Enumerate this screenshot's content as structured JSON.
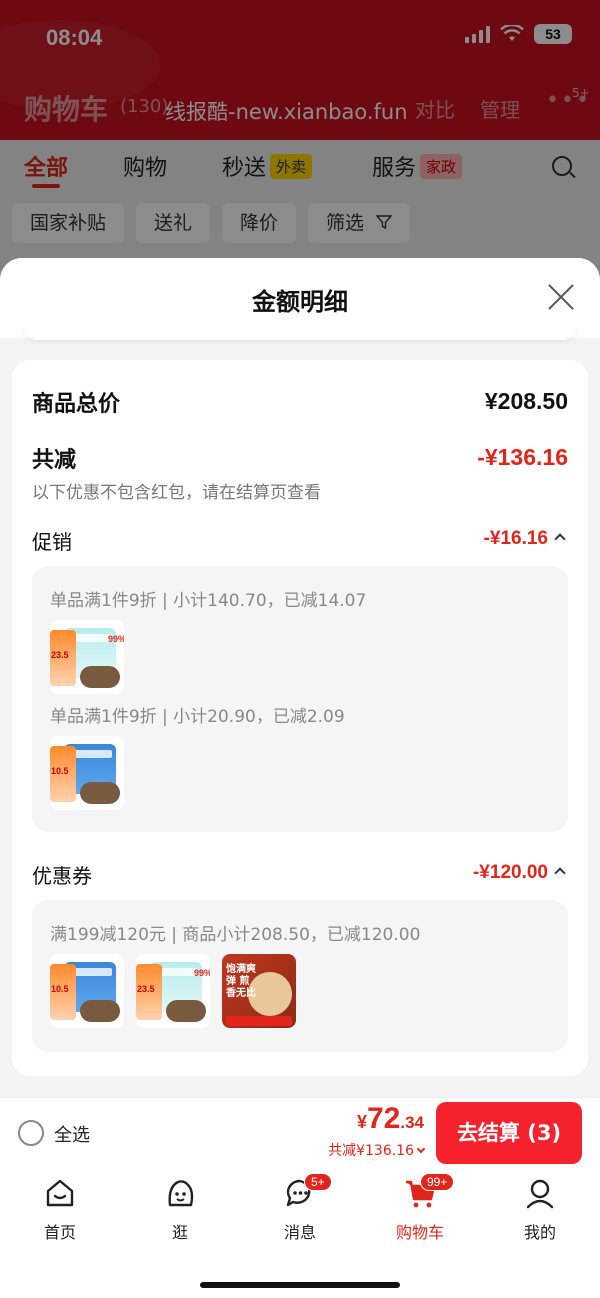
{
  "status_bar": {
    "time": "08:04",
    "battery": "53"
  },
  "header": {
    "title": "购物车",
    "count": "(130)",
    "watermark": "线报酷-new.xianbao.fun",
    "compare": "对比",
    "manage": "管理",
    "more_badge": "5+"
  },
  "tabs": [
    {
      "label": "全部"
    },
    {
      "label": "购物"
    },
    {
      "label": "秒送",
      "tag": "外卖"
    },
    {
      "label": "服务",
      "tag": "家政"
    }
  ],
  "chips": [
    "国家补贴",
    "送礼",
    "降价",
    "筛选"
  ],
  "sheet": {
    "title": "金额明细",
    "goods_total_label": "商品总价",
    "goods_total_value": "¥208.50",
    "discount_label": "共减",
    "discount_value": "-¥136.16",
    "discount_note": "以下优惠不包含红包，请在结算页查看",
    "promo": {
      "label": "促销",
      "value": "-¥16.16",
      "rules": [
        "单品满1件9折 | 小计140.70，已减14.07",
        "单品满1件9折 | 小计20.90，已减2.09"
      ],
      "thumb_prices": [
        "23.5",
        "10.5"
      ]
    },
    "coupon": {
      "label": "优惠券",
      "value": "-¥120.00",
      "rule": "满199减120元 | 商品小计208.50，已减120.00",
      "thumb_prices": [
        "10.5",
        "23.5"
      ],
      "thumb3_text": "饱满爽弹 煎香无比"
    },
    "hot_tag": "99%"
  },
  "checkout": {
    "select_all": "全选",
    "currency": "¥",
    "total_int": "72",
    "total_dec": ".34",
    "saved": "共减¥136.16",
    "pay_button": "去结算 (3)"
  },
  "tabbar": [
    {
      "label": "首页",
      "icon": "home-icon"
    },
    {
      "label": "逛",
      "icon": "browse-icon"
    },
    {
      "label": "消息",
      "icon": "message-icon",
      "badge": "5+"
    },
    {
      "label": "购物车",
      "icon": "cart-icon",
      "badge": "99+",
      "active": true
    },
    {
      "label": "我的",
      "icon": "profile-icon"
    }
  ],
  "colors": {
    "brand_red": "#e1251b",
    "header_red": "#c8101f",
    "button_red": "#f5222d"
  }
}
